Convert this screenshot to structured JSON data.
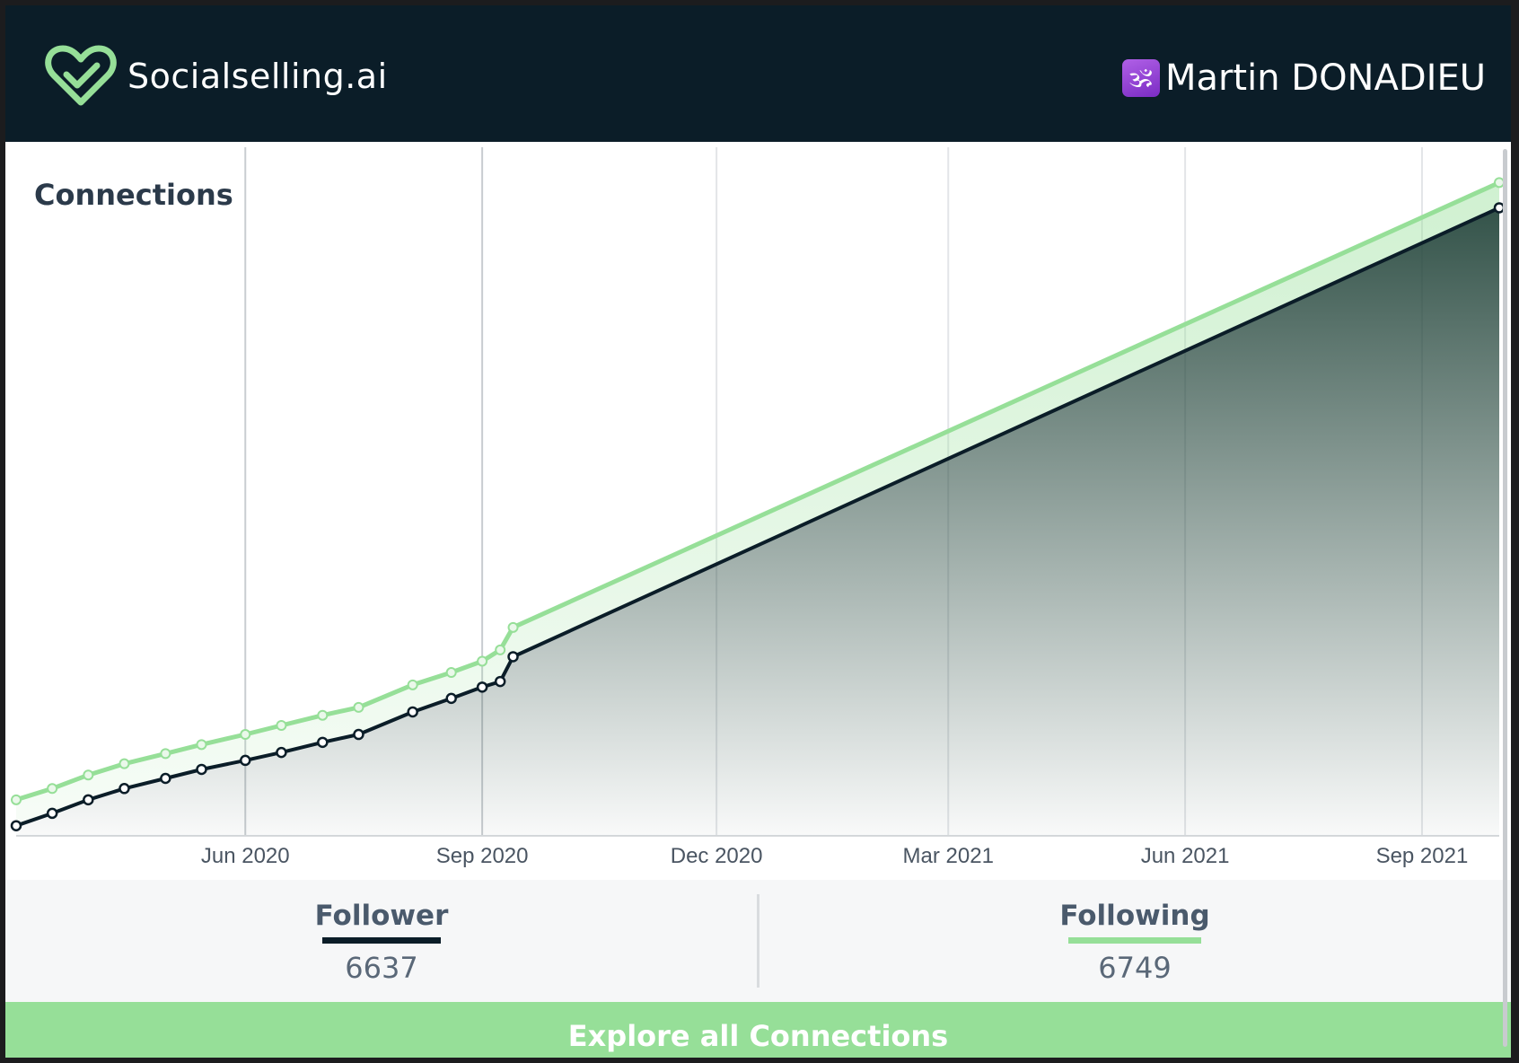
{
  "header": {
    "brand": "Socialselling.ai",
    "user_badge": "🕉",
    "user_name": "Martin DONADIEU",
    "colors": {
      "bar": "#0b1d28",
      "logo": "#96df98"
    }
  },
  "chart_title": "Connections",
  "chart_data": {
    "type": "area",
    "title": "Connections",
    "xlabel": "",
    "ylabel": "",
    "x_ticks": [
      "Jun 2020",
      "Sep 2020",
      "Dec 2020",
      "Mar 2021",
      "Jun 2021",
      "Sep 2021"
    ],
    "x_tick_dates": [
      "2020-06-01",
      "2020-09-01",
      "2020-12-01",
      "2021-03-01",
      "2021-06-01",
      "2021-09-01"
    ],
    "xlim": [
      "2020-03-04",
      "2021-10-01"
    ],
    "ylim": [
      3850,
      6850
    ],
    "grid": "vertical",
    "y_axis_labels": "none",
    "series": [
      {
        "name": "Following",
        "color": "#96df98",
        "fill": "light-green",
        "points": [
          [
            "2020-03-04",
            4010
          ],
          [
            "2020-03-18",
            4060
          ],
          [
            "2020-04-01",
            4120
          ],
          [
            "2020-04-15",
            4170
          ],
          [
            "2020-05-01",
            4215
          ],
          [
            "2020-05-15",
            4255
          ],
          [
            "2020-06-01",
            4300
          ],
          [
            "2020-06-15",
            4340
          ],
          [
            "2020-07-01",
            4385
          ],
          [
            "2020-07-15",
            4420
          ],
          [
            "2020-08-05",
            4520
          ],
          [
            "2020-08-20",
            4575
          ],
          [
            "2020-09-01",
            4625
          ],
          [
            "2020-09-08",
            4675
          ],
          [
            "2020-09-13",
            4775
          ],
          [
            "2021-10-01",
            6749
          ]
        ]
      },
      {
        "name": "Follower",
        "color": "#0b1d28",
        "fill": "dark-gradient",
        "points": [
          [
            "2020-03-04",
            3895
          ],
          [
            "2020-03-18",
            3950
          ],
          [
            "2020-04-01",
            4010
          ],
          [
            "2020-04-15",
            4060
          ],
          [
            "2020-05-01",
            4105
          ],
          [
            "2020-05-15",
            4145
          ],
          [
            "2020-06-01",
            4185
          ],
          [
            "2020-06-15",
            4220
          ],
          [
            "2020-07-01",
            4265
          ],
          [
            "2020-07-15",
            4300
          ],
          [
            "2020-08-05",
            4400
          ],
          [
            "2020-08-20",
            4460
          ],
          [
            "2020-09-01",
            4510
          ],
          [
            "2020-09-08",
            4535
          ],
          [
            "2020-09-13",
            4645
          ],
          [
            "2021-10-01",
            6637
          ]
        ]
      }
    ]
  },
  "stats": {
    "follower": {
      "label": "Follower",
      "value": "6637",
      "color": "#0b1d28"
    },
    "following": {
      "label": "Following",
      "value": "6749",
      "color": "#96df98"
    }
  },
  "cta": {
    "label": "Explore all Connections",
    "color": "#96df98"
  }
}
